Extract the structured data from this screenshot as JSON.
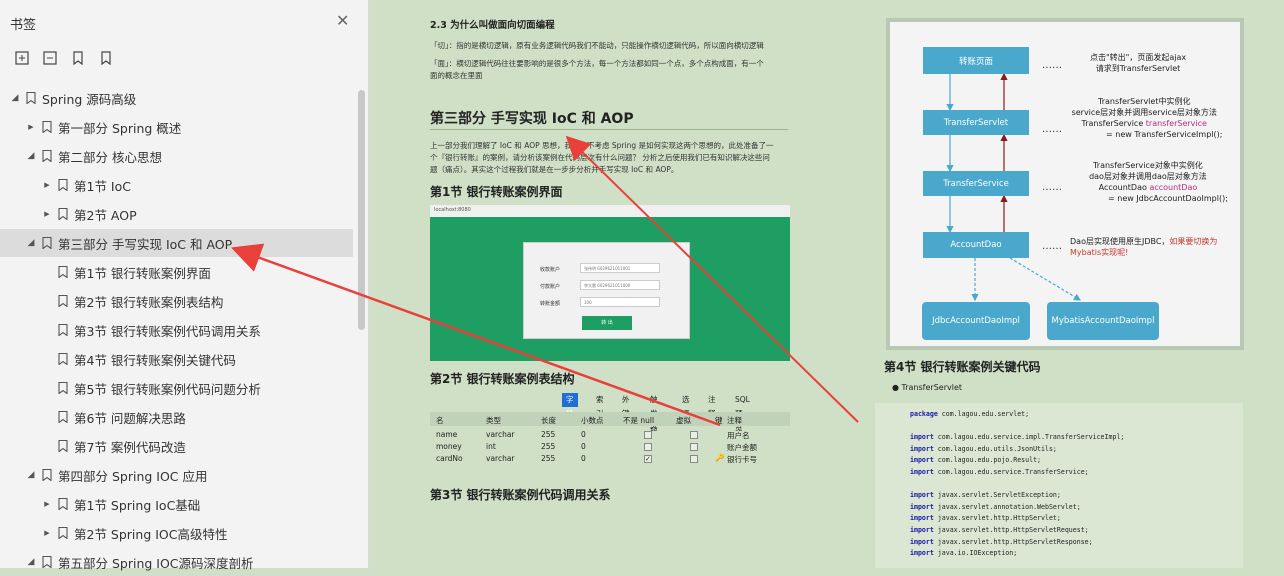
{
  "sidebar": {
    "title": "书签",
    "items": [
      {
        "label": "Spring 源码高级",
        "level": 0,
        "expanded": true
      },
      {
        "label": "第一部分 Spring 概述",
        "level": 1,
        "expanded": false
      },
      {
        "label": "第二部分 核心思想",
        "level": 1,
        "expanded": true
      },
      {
        "label": "第1节 IoC",
        "level": 2,
        "expanded": false
      },
      {
        "label": "第2节 AOP",
        "level": 2,
        "expanded": false
      },
      {
        "label": "第三部分 手写实现 IoC 和 AOP",
        "level": 1,
        "expanded": true,
        "selected": true
      },
      {
        "label": "第1节 银行转账案例界面",
        "level": 2,
        "leaf": true
      },
      {
        "label": "第2节 银行转账案例表结构",
        "level": 2,
        "leaf": true
      },
      {
        "label": "第3节 银行转账案例代码调用关系",
        "level": 2,
        "leaf": true
      },
      {
        "label": "第4节 银行转账案例关键代码",
        "level": 2,
        "leaf": true
      },
      {
        "label": "第5节 银行转账案例代码问题分析",
        "level": 2,
        "leaf": true
      },
      {
        "label": "第6节 问题解决思路",
        "level": 2,
        "leaf": true
      },
      {
        "label": "第7节 案例代码改造",
        "level": 2,
        "leaf": true
      },
      {
        "label": "第四部分 Spring IOC 应用",
        "level": 1,
        "expanded": true
      },
      {
        "label": "第1节 Spring IoC基础",
        "level": 2,
        "expanded": false
      },
      {
        "label": "第2节 Spring IOC高级特性",
        "level": 2,
        "expanded": false
      },
      {
        "label": "第五部分 Spring IOC源码深度剖析",
        "level": 1,
        "expanded": true
      }
    ]
  },
  "page": {
    "sec23_title": "2.3 为什么叫做面向切面编程",
    "sec23_p1": "「切」：指的是横切逻辑，原有业务逻辑代码我们不能动，只能操作横切逻辑代码，所以面向横切逻辑",
    "sec23_p2a": "「面」：横切逻辑代码往往要影响的是很多个方法，每一个方法都如同一个点，多个点构成面，有一个",
    "sec23_p2b": "面的概念在里面",
    "part3_title": "第三部分 手写实现 IoC 和 AOP",
    "part3_p1": "上一部分我们理解了 IoC 和 AOP 思想，我们先不考虑 Spring 是如何实现这两个思想的，此处准备了一",
    "part3_p2": "个『银行转账』的案例，请分析该案例在代码层次有什么问题？ 分析之后使用我们已有知识解决这些问",
    "part3_p3": "题（痛点）。其实这个过程我们就是在一步步分析并手写实现 IoC 和 AOP。",
    "sec1_title": "第1节 银行转账案例界面",
    "sec2_title": "第2节 银行转账案例表结构",
    "sec3_title": "第3节 银行转账案例代码调用关系",
    "sec4_title": "第4节 银行转账案例关键代码",
    "bullet": "TransferServlet"
  },
  "app": {
    "url": "localhost:8080",
    "rows": [
      {
        "label": "收款账户",
        "value": "张伟明 6029621011001"
      },
      {
        "label": "付款账户",
        "value": "李大雷 6029621011000"
      },
      {
        "label": "转账金额",
        "value": "100"
      }
    ],
    "button": "转 出"
  },
  "db": {
    "tabs": [
      "字段",
      "索引",
      "外键",
      "触发器",
      "选项",
      "注释",
      "SQL 预览"
    ],
    "headers": [
      "名",
      "类型",
      "长度",
      "小数点",
      "不是 null",
      "虚拟",
      "键",
      "注释"
    ],
    "rows": [
      {
        "name": "name",
        "type": "varchar",
        "len": "255",
        "dec": "0",
        "notnull": false,
        "comment": "用户名"
      },
      {
        "name": "money",
        "type": "int",
        "len": "255",
        "dec": "0",
        "notnull": false,
        "comment": "账户金额"
      },
      {
        "name": "cardNo",
        "type": "varchar",
        "len": "255",
        "dec": "0",
        "notnull": true,
        "comment": "银行卡号"
      }
    ]
  },
  "diagram": {
    "boxes": [
      "转账页面",
      "TransferServlet",
      "TransferService",
      "AccountDao",
      "JdbcAccountDaoImpl",
      "MybatisAccountDaoImpl"
    ],
    "dots": "……",
    "note1": [
      "点击\"转出\"，页面发起ajax",
      "请求到TransferServlet"
    ],
    "note2": [
      "TransferServlet中实例化",
      "service层对象并调用service层对象方法",
      "TransferService ",
      "transferService",
      "= new TransferServiceImpl();"
    ],
    "note3": [
      "TransferService对象中实例化",
      "dao层对象并调用dao层对象方法",
      "AccountDao ",
      "accountDao",
      "= new JdbcAccountDaoImpl();"
    ],
    "note4": [
      "Dao层实现使用原生JDBC，",
      "如果要切换为",
      "Mybatis实现呢!"
    ]
  },
  "code": {
    "lines": [
      [
        "package",
        " com.lagou.edu.servlet;"
      ],
      [
        "",
        ""
      ],
      [
        "import",
        " com.lagou.edu.service.impl.TransferServiceImpl;"
      ],
      [
        "import",
        " com.lagou.edu.utils.JsonUtils;"
      ],
      [
        "import",
        " com.lagou.edu.pojo.Result;"
      ],
      [
        "import",
        " com.lagou.edu.service.TransferService;"
      ],
      [
        "",
        ""
      ],
      [
        "import",
        " javax.servlet.ServletException;"
      ],
      [
        "import",
        " javax.servlet.annotation.WebServlet;"
      ],
      [
        "import",
        " javax.servlet.http.HttpServlet;"
      ],
      [
        "import",
        " javax.servlet.http.HttpServletRequest;"
      ],
      [
        "import",
        " javax.servlet.http.HttpServletResponse;"
      ],
      [
        "import",
        " java.io.IOException;"
      ]
    ]
  },
  "colors": {
    "accent_arrow": "#e8403a",
    "box": "#4aa8cc",
    "dark_arrow": "#8b1a1a"
  }
}
